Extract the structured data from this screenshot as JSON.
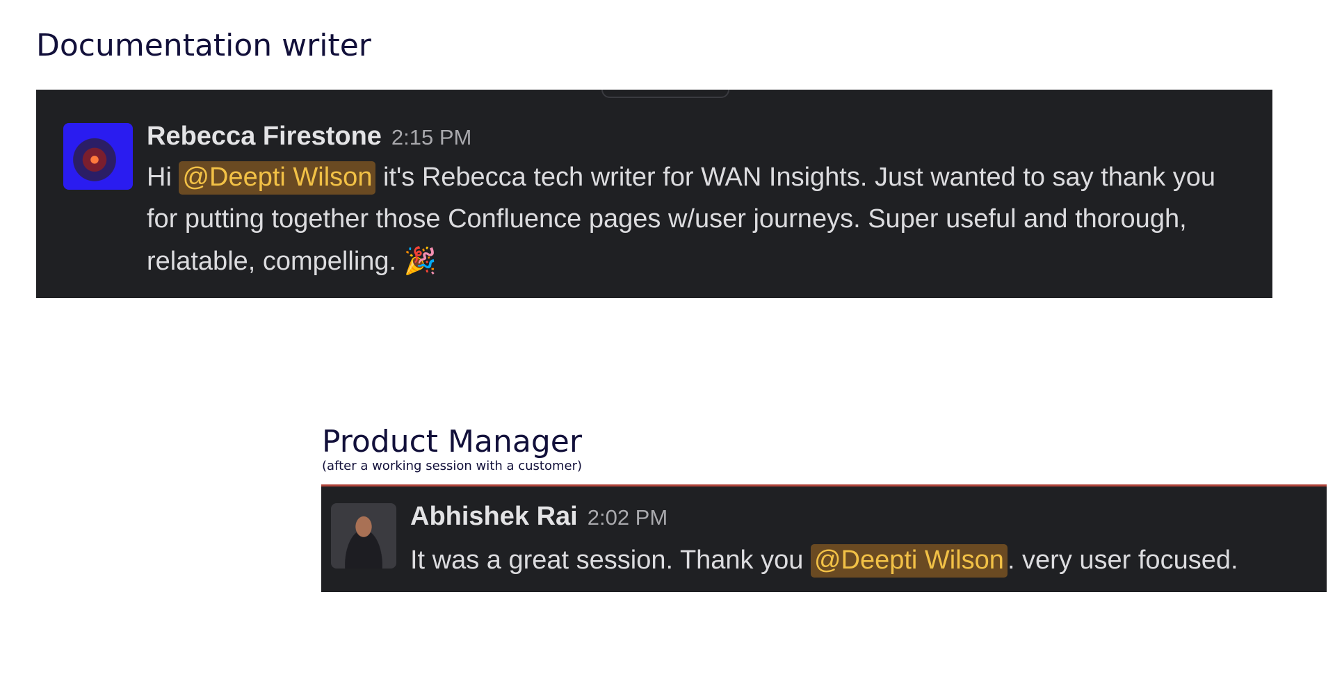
{
  "sections": [
    {
      "title": "Documentation writer",
      "message": {
        "author": "Rebecca Firestone",
        "time": "2:15 PM",
        "text_before": "Hi ",
        "mention": "@Deepti Wilson",
        "text_after": " it's Rebecca tech writer for WAN Insights. Just wanted to say thank you for putting together those Confluence pages w/user journeys. Super useful and thorough, relatable, compelling. ",
        "emoji": "🎉",
        "emoji_name": "party-popper-icon"
      }
    },
    {
      "title": "Product Manager",
      "subtitle": "(after a working session with a customer)",
      "message": {
        "author": "Abhishek Rai",
        "time": "2:02 PM",
        "text_before": "It was a great session. Thank you ",
        "mention": "@Deepti Wilson",
        "text_after": ". very user focused."
      }
    }
  ],
  "colors": {
    "title_text": "#12103a",
    "message_bg": "#1f2023",
    "mention_bg": "#6a4a22",
    "mention_text": "#f2c146",
    "card2_top_border": "#b0443a"
  }
}
